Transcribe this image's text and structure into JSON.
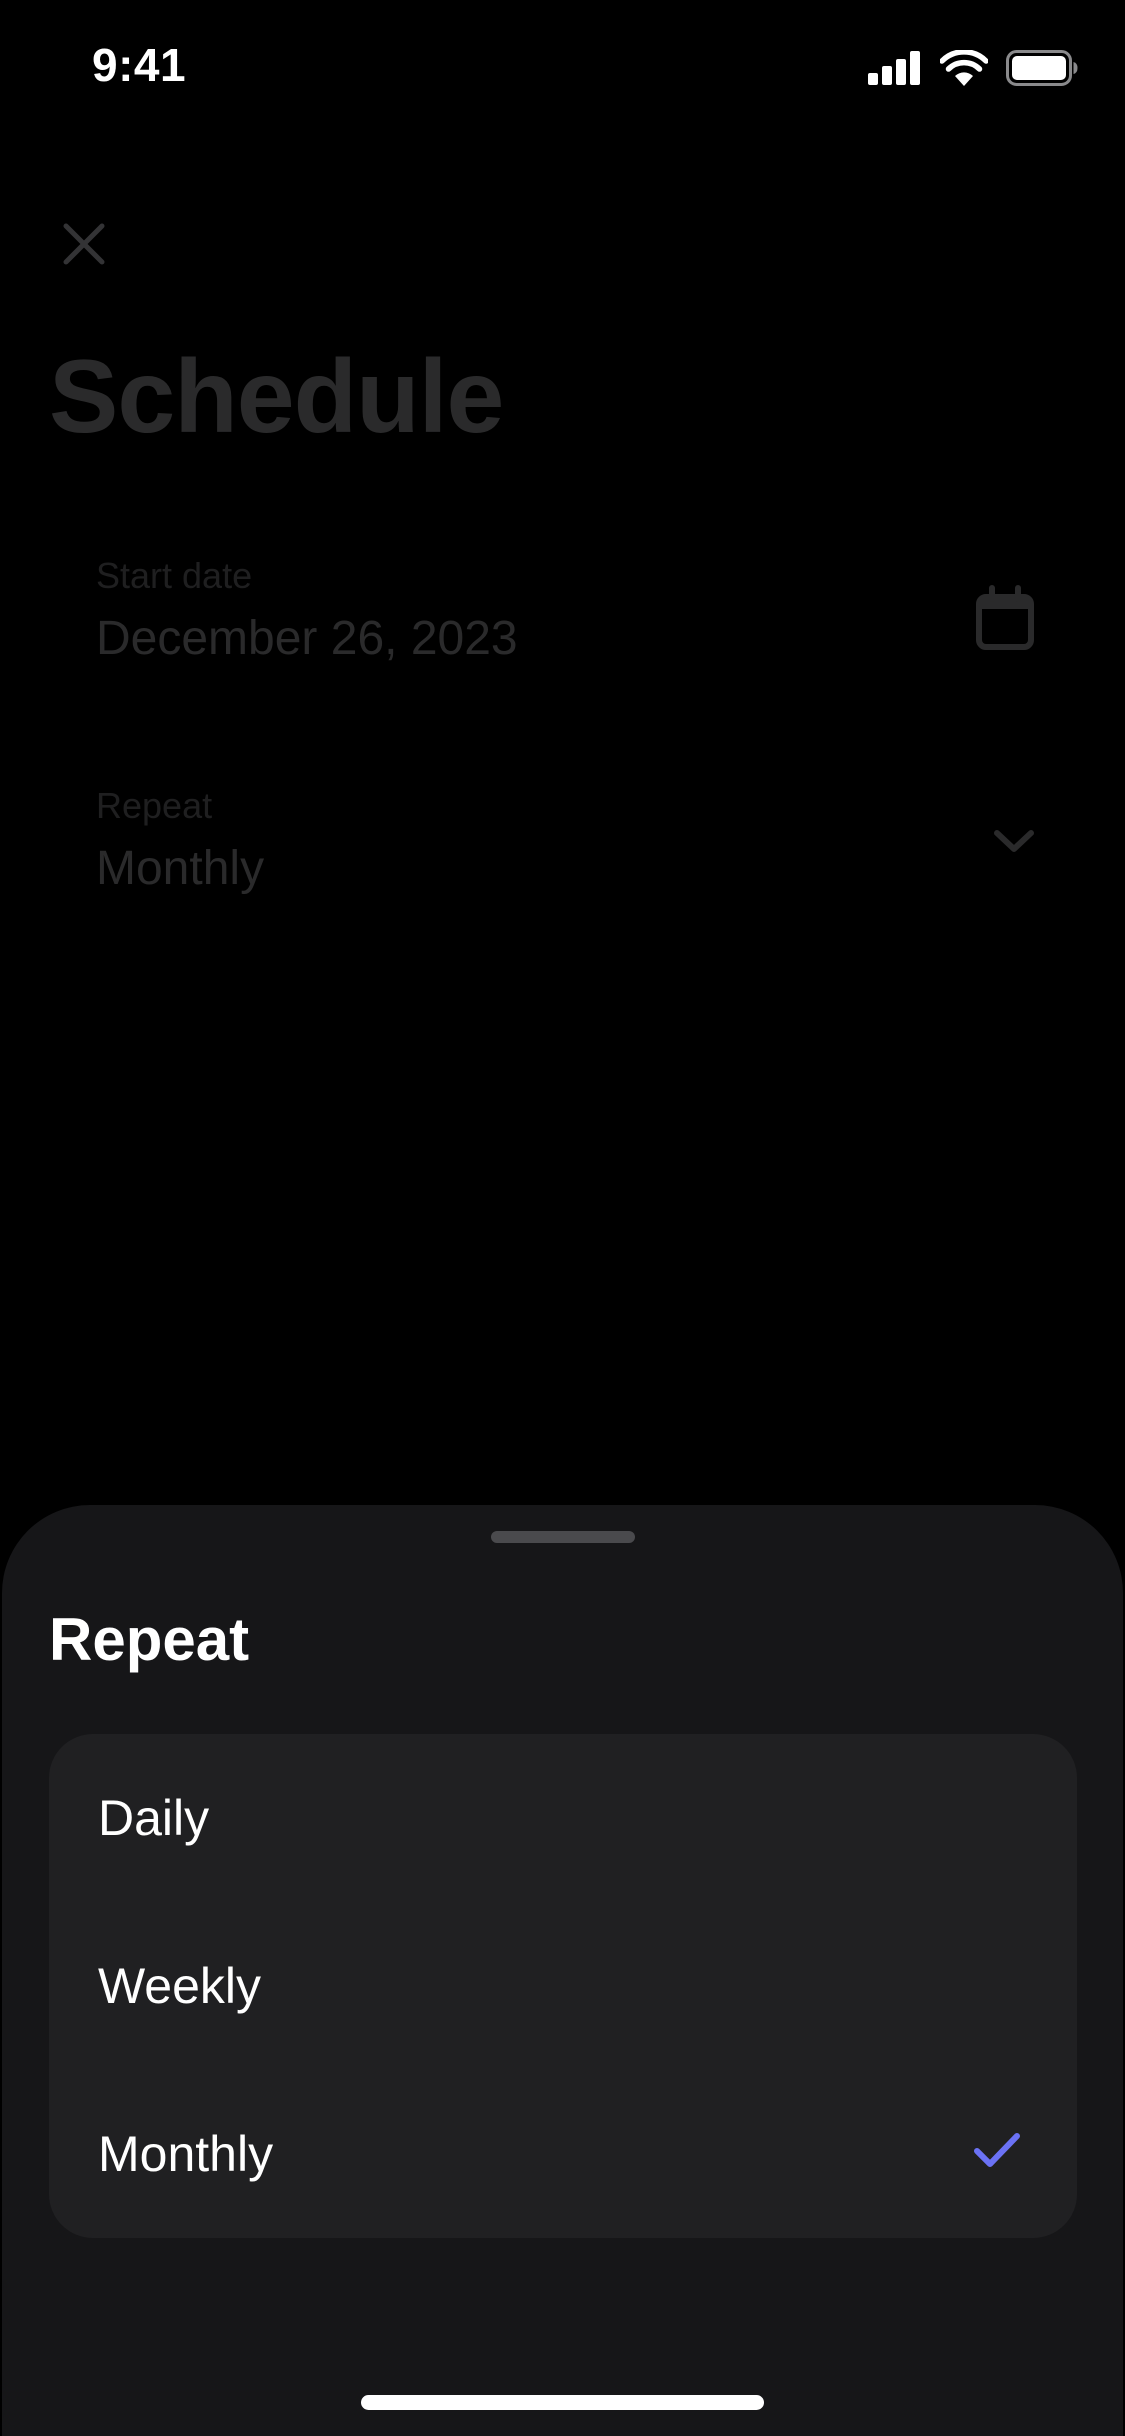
{
  "status_bar": {
    "time": "9:41",
    "icons": [
      "cellular-signal-icon",
      "wifi-icon",
      "battery-icon"
    ]
  },
  "page": {
    "close_icon": "close-icon",
    "title": "Schedule",
    "start_date": {
      "label": "Start date",
      "value": "December 26, 2023",
      "icon": "calendar-icon"
    },
    "repeat": {
      "label": "Repeat",
      "value": "Monthly",
      "icon": "chevron-down-icon"
    }
  },
  "sheet": {
    "title": "Repeat",
    "options": [
      {
        "label": "Daily",
        "selected": false
      },
      {
        "label": "Weekly",
        "selected": false
      },
      {
        "label": "Monthly",
        "selected": true
      }
    ],
    "selected_icon": "checkmark-icon"
  },
  "colors": {
    "background": "#000000",
    "sheet_background": "#161618",
    "option_group_background": "#202022",
    "accent": "#6b72f5",
    "dimmed_text": "#2a2a2b"
  }
}
